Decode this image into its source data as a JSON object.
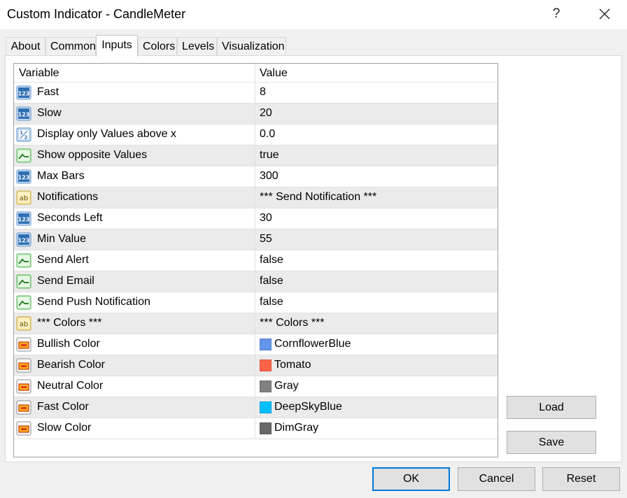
{
  "window": {
    "title": "Custom Indicator - CandleMeter",
    "help_label": "?",
    "close_icon": "close-icon"
  },
  "tabs": [
    {
      "label": "About"
    },
    {
      "label": "Common"
    },
    {
      "label": "Inputs",
      "active": true
    },
    {
      "label": "Colors"
    },
    {
      "label": "Levels"
    },
    {
      "label": "Visualization"
    }
  ],
  "grid": {
    "columns": {
      "variable": "Variable",
      "value": "Value"
    },
    "rows": [
      {
        "type": "int",
        "icon": "integer-123-icon",
        "name": "Fast",
        "value": "8"
      },
      {
        "type": "int",
        "icon": "integer-123-icon",
        "name": "Slow",
        "value": "20"
      },
      {
        "type": "double",
        "icon": "fraction-half-icon",
        "name": "Display only Values above x",
        "value": "0.0"
      },
      {
        "type": "bool",
        "icon": "boolean-toggle-icon",
        "name": "Show opposite Values",
        "value": "true"
      },
      {
        "type": "int",
        "icon": "integer-123-icon",
        "name": "Max Bars",
        "value": "300"
      },
      {
        "type": "string",
        "icon": "string-ab-icon",
        "name": "Notifications",
        "value": "*** Send Notification ***"
      },
      {
        "type": "int",
        "icon": "integer-123-icon",
        "name": "Seconds Left",
        "value": "30"
      },
      {
        "type": "int",
        "icon": "integer-123-icon",
        "name": "Min Value",
        "value": "55"
      },
      {
        "type": "bool",
        "icon": "boolean-toggle-icon",
        "name": "Send Alert",
        "value": "false"
      },
      {
        "type": "bool",
        "icon": "boolean-toggle-icon",
        "name": "Send Email",
        "value": "false"
      },
      {
        "type": "bool",
        "icon": "boolean-toggle-icon",
        "name": "Send Push Notification",
        "value": "false"
      },
      {
        "type": "string",
        "icon": "string-ab-icon",
        "name": "*** Colors ***",
        "value": "*** Colors ***"
      },
      {
        "type": "color",
        "icon": "color-icon",
        "name": "Bullish Color",
        "value": "CornflowerBlue",
        "color": "#6495ED"
      },
      {
        "type": "color",
        "icon": "color-icon",
        "name": "Bearish Color",
        "value": "Tomato",
        "color": "#FF6347"
      },
      {
        "type": "color",
        "icon": "color-icon",
        "name": "Neutral Color",
        "value": "Gray",
        "color": "#808080"
      },
      {
        "type": "color",
        "icon": "color-icon",
        "name": "Fast Color",
        "value": "DeepSkyBlue",
        "color": "#00BFFF"
      },
      {
        "type": "color",
        "icon": "color-icon",
        "name": "Slow Color",
        "value": "DimGray",
        "color": "#696969"
      }
    ]
  },
  "side_buttons": {
    "load": "Load",
    "save": "Save"
  },
  "dialog_buttons": {
    "ok": "OK",
    "cancel": "Cancel",
    "reset": "Reset"
  },
  "colors": {
    "accent": "#0078d7",
    "row_alt": "#ebebeb"
  }
}
